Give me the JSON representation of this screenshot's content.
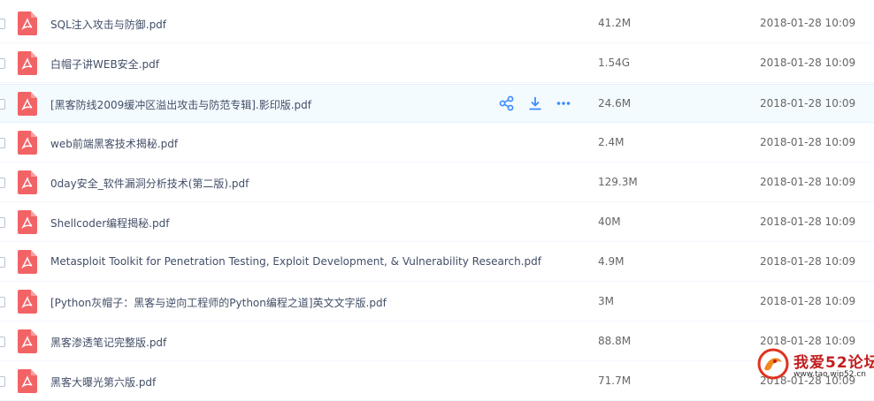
{
  "files": [
    {
      "name": "SQL注入攻击与防御.pdf",
      "size": "41.2M",
      "date": "2018-01-28 10:09"
    },
    {
      "name": "白帽子讲WEB安全.pdf",
      "size": "1.54G",
      "date": "2018-01-28 10:09"
    },
    {
      "name": "[黑客防线2009缓冲区溢出攻击与防范专辑].影印版.pdf",
      "size": "24.6M",
      "date": "2018-01-28 10:09"
    },
    {
      "name": "web前端黑客技术揭秘.pdf",
      "size": "2.4M",
      "date": "2018-01-28 10:09"
    },
    {
      "name": "0day安全_软件漏洞分析技术(第二版).pdf",
      "size": "129.3M",
      "date": "2018-01-28 10:09"
    },
    {
      "name": "Shellcoder编程揭秘.pdf",
      "size": "40M",
      "date": "2018-01-28 10:09"
    },
    {
      "name": "Metasploit Toolkit for Penetration Testing, Exploit Development, & Vulnerability Research.pdf",
      "size": "4.9M",
      "date": "2018-01-28 10:09"
    },
    {
      "name": "[Python灰帽子：黑客与逆向工程师的Python编程之道]英文文字版.pdf",
      "size": "3M",
      "date": "2018-01-28 10:09"
    },
    {
      "name": "黑客渗透笔记完整版.pdf",
      "size": "88.8M",
      "date": "2018-01-28 10:09"
    },
    {
      "name": "黑客大曝光第六版.pdf",
      "size": "71.7M",
      "date": "2018-01-28 10:09"
    }
  ],
  "hover_row": 2,
  "actions": [
    {
      "icon": "share-icon"
    },
    {
      "icon": "download-icon"
    },
    {
      "icon": "more-icon"
    }
  ],
  "colors": {
    "pdf_icon": "#f26366",
    "action_icon": "#3b8cff",
    "hover_row_bg": "#f4fbff"
  },
  "watermark": {
    "title": "我爱52论坛",
    "url": "www.tao.wip52.cn"
  }
}
